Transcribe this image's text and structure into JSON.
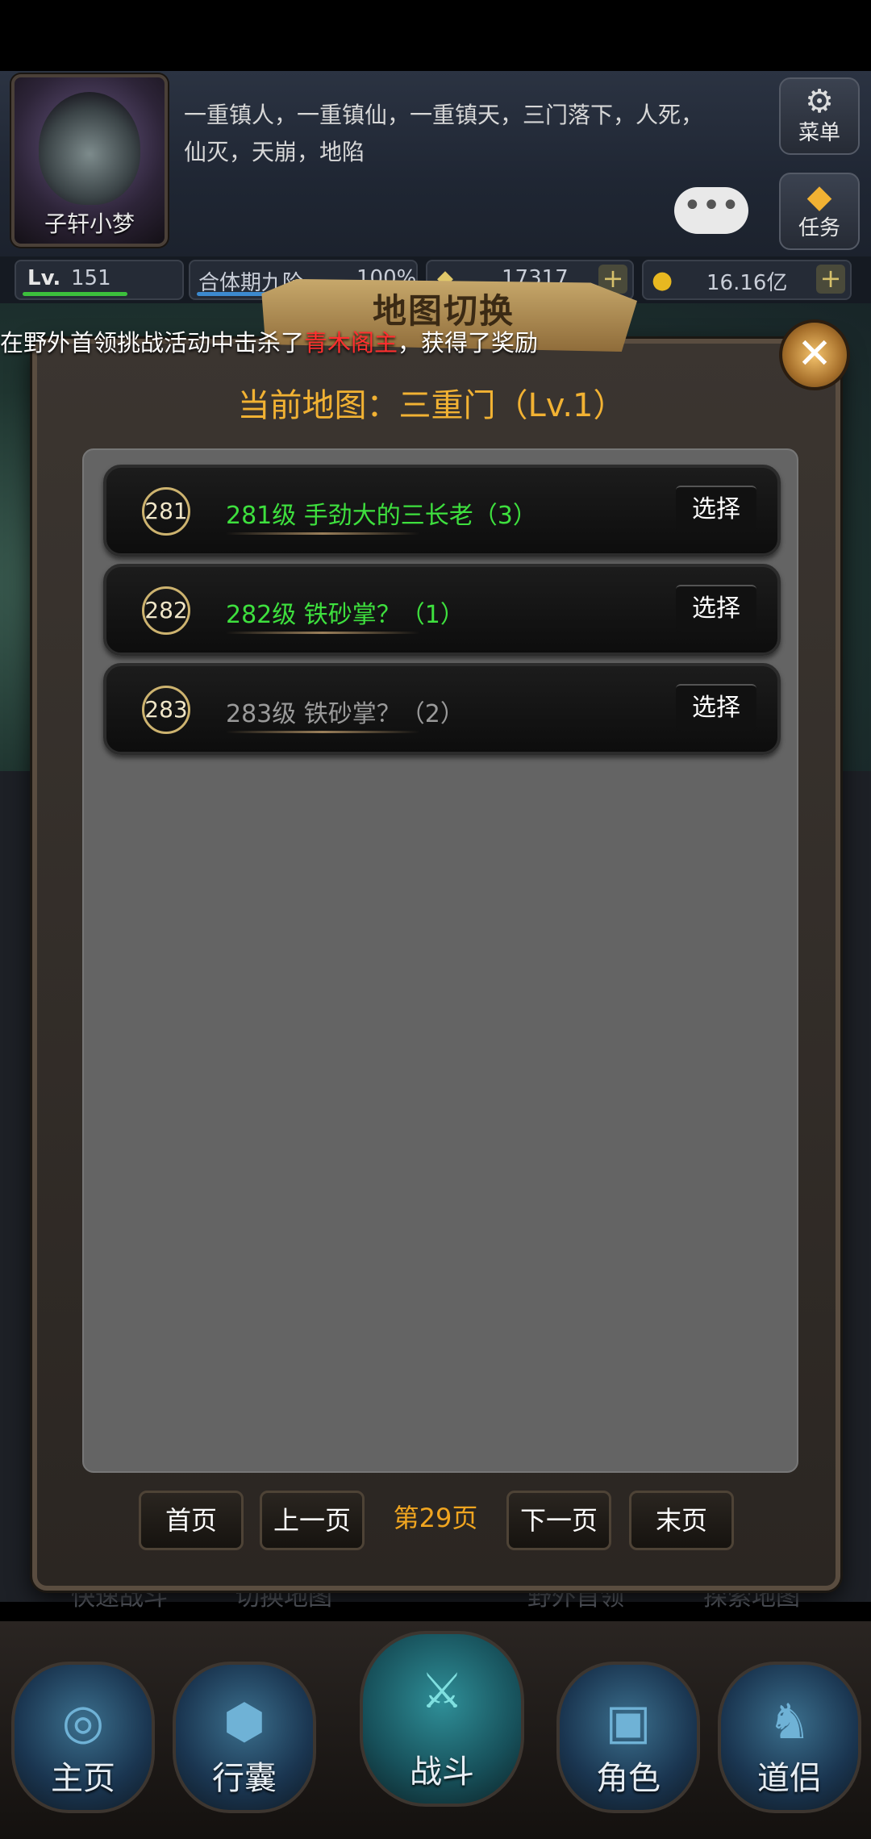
{
  "header": {
    "player_name": "子轩小梦",
    "motto_line1": "一重镇人，一重镇仙，一重镇天，三门落下，人死，",
    "motto_line2": "仙灭，天崩，地陷",
    "menu_label": "菜单",
    "task_label": "任务",
    "chat_icon": "chat-bubble-icon"
  },
  "stats": {
    "level_prefix": "Lv.",
    "level": "151",
    "realm": "合体期九阶",
    "realm_percent": "100%",
    "realm_progress": 1.0,
    "gems": "17317",
    "gold": "16.16亿"
  },
  "announcement": {
    "prefix": "在野外首领挑战活动中击杀了",
    "boss": "青木阁主",
    "suffix": "，获得了奖励"
  },
  "dialog": {
    "title": "地图切换",
    "current_map": "当前地图：三重门（Lv.1）",
    "close_icon": "close-x-icon",
    "rows": [
      {
        "num": "281",
        "text": "281级 手劲大的三长老（3）",
        "status": "green",
        "button": "选择"
      },
      {
        "num": "282",
        "text": "282级 铁砂掌？（1）",
        "status": "green",
        "button": "选择"
      },
      {
        "num": "283",
        "text": "283级 铁砂掌？（2）",
        "status": "gray",
        "button": "选择"
      }
    ],
    "pagination": {
      "first": "首页",
      "prev": "上一页",
      "current": "第29页",
      "next": "下一页",
      "last": "末页"
    }
  },
  "bottom_actions": [
    "快速战斗",
    "切换地图",
    "野外首领",
    "探索地图"
  ],
  "nav": [
    "主页",
    "行囊",
    "战斗",
    "角色",
    "道侣"
  ],
  "colors": {
    "accent": "#f2b233",
    "green": "#3ee03e",
    "red": "#ff2f2f"
  }
}
